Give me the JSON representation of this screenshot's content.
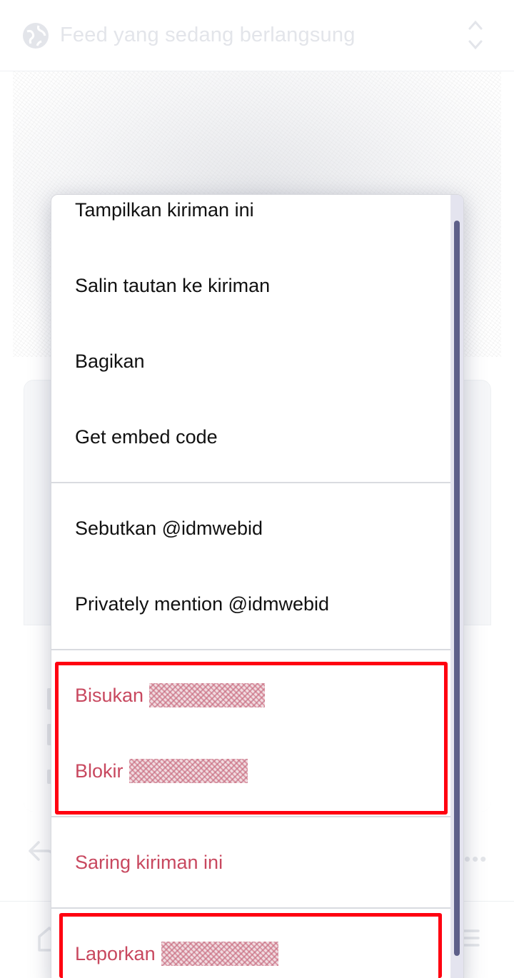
{
  "header": {
    "title": "Feed yang sedang berlangsung"
  },
  "icons": {
    "globe": "globe-icon",
    "sort": "up-down-chevrons-icon",
    "reply": "reply-icon",
    "more": "more-horizontal-icon",
    "home": "home-icon",
    "menu": "hamburger-menu-icon"
  },
  "menu": {
    "group1": [
      "Tampilkan kiriman ini",
      "Salin tautan ke kiriman",
      "Bagikan",
      "Get embed code"
    ],
    "group2": [
      "Sebutkan @idmwebid",
      "Privately mention @idmwebid"
    ],
    "group3": [
      "Bisukan",
      "Blokir"
    ],
    "group4": [
      "Saring kiriman ini"
    ],
    "group5": [
      "Laporkan"
    ]
  },
  "colors": {
    "danger_text": "#c8485f",
    "highlight": "#ff0010",
    "scroll_thumb": "#5d5f89"
  }
}
